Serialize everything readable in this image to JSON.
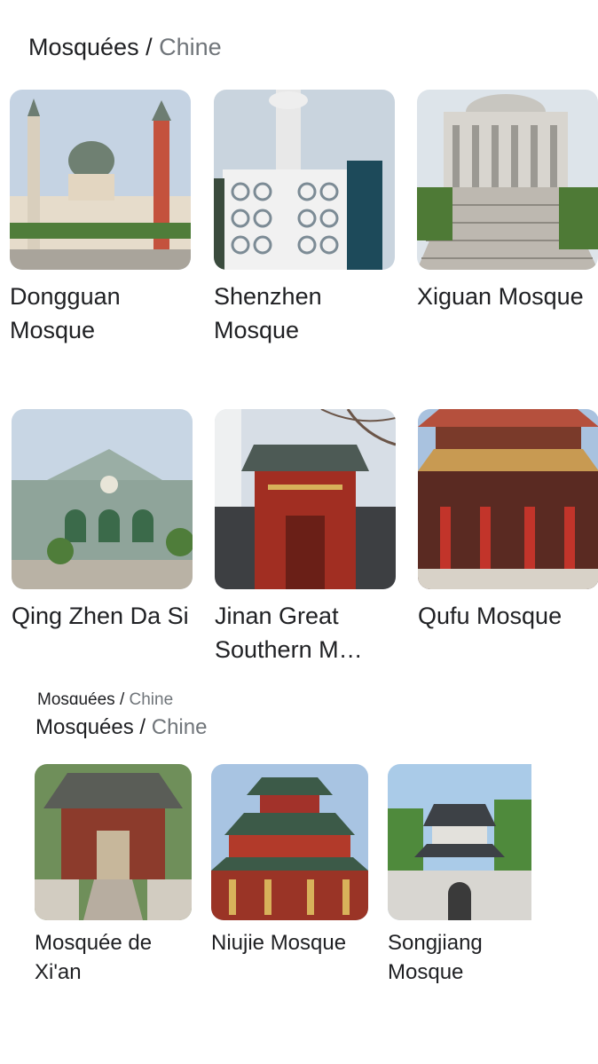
{
  "header": {
    "root": "Mosquées",
    "separator": "/",
    "leaf": "Chine"
  },
  "ghost_header": {
    "root": "Mosquées",
    "separator": "/",
    "leaf": "Chine"
  },
  "lower_header": {
    "root": "Mosquées",
    "separator": "/",
    "leaf": "Chine"
  },
  "grid": {
    "items": [
      {
        "title": "Dongguan Mosque",
        "image": "mosque-photo"
      },
      {
        "title": "Shenzhen Mosque",
        "image": "mosque-photo"
      },
      {
        "title": "Xiguan Mosque",
        "image": "mosque-photo"
      },
      {
        "title": "Qing Zhen Da Si",
        "image": "mosque-photo"
      },
      {
        "title": "Jinan Great Southern M…",
        "image": "mosque-photo"
      },
      {
        "title": "Qufu Mosque",
        "image": "mosque-photo"
      }
    ]
  },
  "lower": {
    "items": [
      {
        "title": "Mosquée de Xi'an",
        "image": "mosque-photo"
      },
      {
        "title": "Niujie Mosque",
        "image": "mosque-photo"
      },
      {
        "title": "Songjiang Mosque",
        "image": "mosque-photo"
      }
    ]
  },
  "colors": {
    "text": "#202124",
    "muted": "#70757a",
    "sky": "#b9cbe0",
    "roof_red": "#b23a2a",
    "stone": "#c9c0b0"
  }
}
